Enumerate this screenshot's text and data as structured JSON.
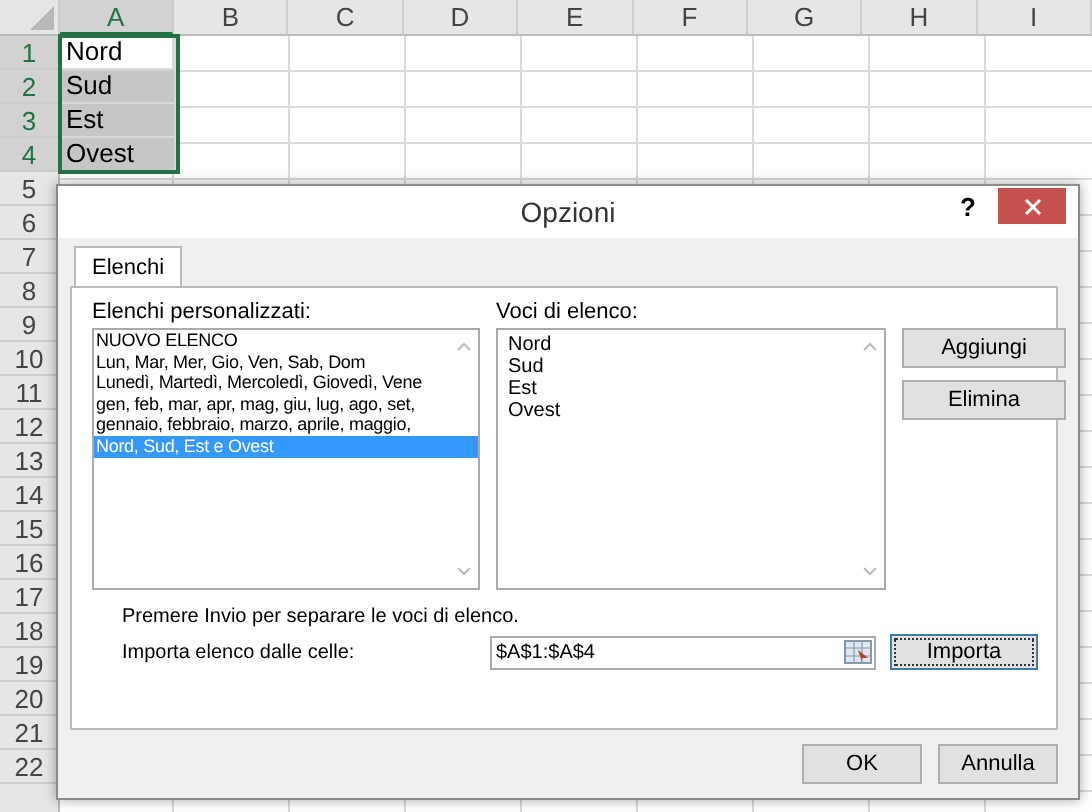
{
  "sheet": {
    "columns": [
      {
        "label": "A",
        "selected": true
      },
      {
        "label": "B",
        "selected": false
      },
      {
        "label": "C",
        "selected": false
      },
      {
        "label": "D",
        "selected": false
      },
      {
        "label": "E",
        "selected": false
      },
      {
        "label": "F",
        "selected": false
      },
      {
        "label": "G",
        "selected": false
      },
      {
        "label": "H",
        "selected": false
      },
      {
        "label": "I",
        "selected": false
      }
    ],
    "rows": [
      {
        "number": "1",
        "selected": true,
        "cell_a": {
          "text": "Nord",
          "selected": false
        }
      },
      {
        "number": "2",
        "selected": true,
        "cell_a": {
          "text": "Sud",
          "selected": true
        }
      },
      {
        "number": "3",
        "selected": true,
        "cell_a": {
          "text": "Est",
          "selected": true
        }
      },
      {
        "number": "4",
        "selected": true,
        "cell_a": {
          "text": "Ovest",
          "selected": true
        }
      },
      {
        "number": "5",
        "selected": false
      },
      {
        "number": "6",
        "selected": false
      },
      {
        "number": "7",
        "selected": false
      },
      {
        "number": "8",
        "selected": false
      },
      {
        "number": "9",
        "selected": false
      },
      {
        "number": "10",
        "selected": false
      },
      {
        "number": "11",
        "selected": false
      },
      {
        "number": "12",
        "selected": false
      },
      {
        "number": "13",
        "selected": false
      },
      {
        "number": "14",
        "selected": false
      },
      {
        "number": "15",
        "selected": false
      },
      {
        "number": "16",
        "selected": false
      },
      {
        "number": "17",
        "selected": false
      },
      {
        "number": "18",
        "selected": false
      },
      {
        "number": "19",
        "selected": false
      },
      {
        "number": "20",
        "selected": false
      },
      {
        "number": "21",
        "selected": false
      },
      {
        "number": "22",
        "selected": false
      }
    ]
  },
  "dialog": {
    "title": "Opzioni",
    "help": "?",
    "tabs": [
      {
        "label": "Elenchi",
        "selected": true
      }
    ],
    "custom_lists": {
      "label": "Elenchi personalizzati:",
      "items": [
        {
          "text": "NUOVO ELENCO",
          "selected": false
        },
        {
          "text": "Lun, Mar, Mer, Gio, Ven, Sab, Dom",
          "selected": false
        },
        {
          "text": "Lunedì, Martedì, Mercoledì, Giovedì, Vene",
          "selected": false
        },
        {
          "text": "gen, feb, mar, apr, mag, giu, lug, ago, set,",
          "selected": false
        },
        {
          "text": "gennaio, febbraio, marzo, aprile, maggio,",
          "selected": false
        },
        {
          "text": "Nord, Sud, Est e Ovest",
          "selected": true
        }
      ]
    },
    "list_entries": {
      "label": "Voci di elenco:",
      "lines": [
        "Nord",
        "Sud",
        "Est",
        "Ovest"
      ]
    },
    "side_buttons": [
      "Aggiungi",
      "Elimina"
    ],
    "hint": "Premere Invio per separare le voci di elenco.",
    "import": {
      "label": "Importa elenco dalle celle:",
      "value": "$A$1:$A$4",
      "button": "Importa"
    },
    "buttons": [
      "OK",
      "Annulla"
    ]
  }
}
